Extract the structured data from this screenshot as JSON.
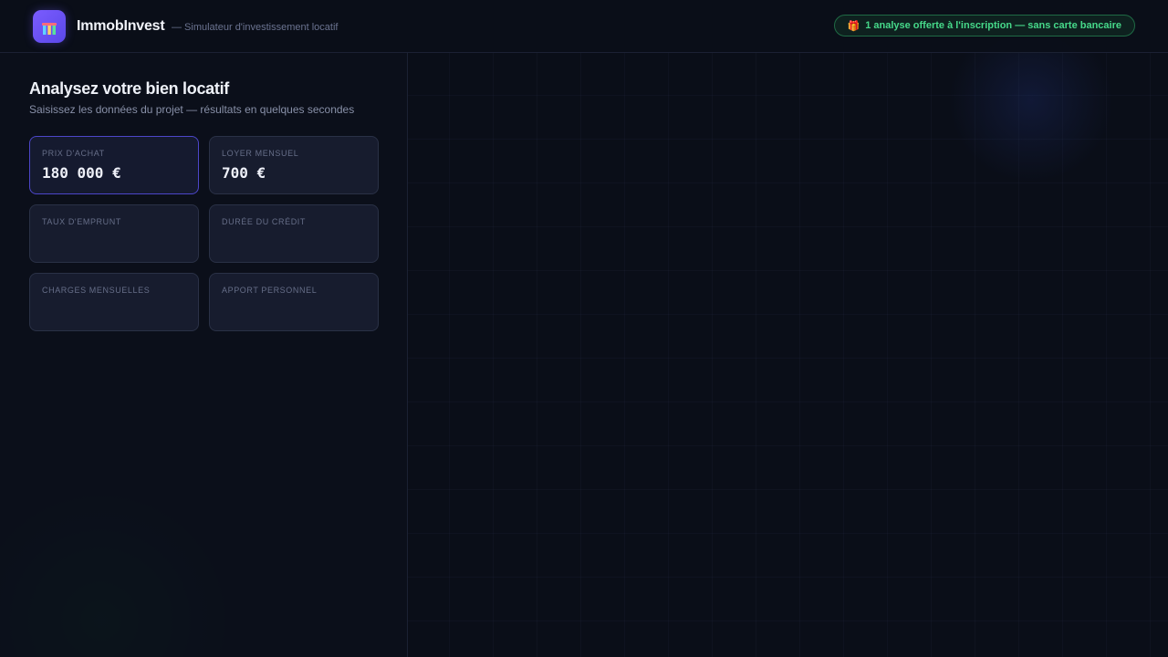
{
  "header": {
    "brand": "ImmobInvest",
    "tagline": "— Simulateur d'investissement locatif",
    "promo_icon": "🎁",
    "promo_text": "1 analyse offerte à l'inscription — sans carte bancaire"
  },
  "form": {
    "title": "Analysez votre bien locatif",
    "subtitle": "Saisissez les données du projet — résultats en quelques secondes",
    "fields": [
      {
        "label": "PRIX D'ACHAT",
        "value": "180 000 €"
      },
      {
        "label": "LOYER MENSUEL",
        "value": "700 €"
      },
      {
        "label": "TAUX D'EMPRUNT",
        "value": ""
      },
      {
        "label": "DURÉE DU CRÉDIT",
        "value": ""
      },
      {
        "label": "CHARGES MENSUELLES",
        "value": ""
      },
      {
        "label": "APPORT PERSONNEL",
        "value": ""
      }
    ]
  },
  "colors": {
    "background": "#0a0e18",
    "accent": "#5a48e8",
    "promo_green": "#46d98a",
    "field_bg": "#171c2e"
  },
  "icons": {
    "logo": "building-chart-icon",
    "promo": "gift-icon"
  }
}
